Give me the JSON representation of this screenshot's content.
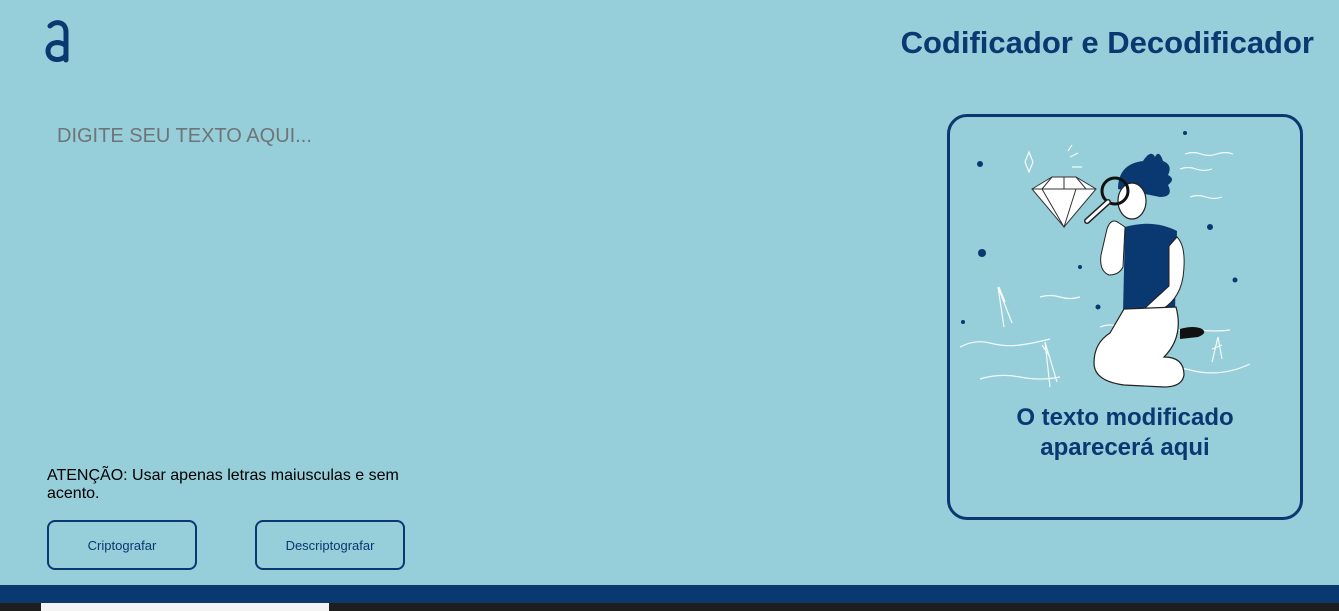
{
  "header": {
    "logo_icon": "alura-logo-icon",
    "title": "Codificador e Decodificador"
  },
  "editor": {
    "placeholder": "DIGITE SEU TEXTO AQUI..."
  },
  "warning": {
    "text": "ATENÇÃO: Usar apenas letras maiusculas e sem acento."
  },
  "buttons": {
    "encrypt_label": "Criptografar",
    "decrypt_label": "Descriptografar"
  },
  "output": {
    "illustration_icon": "person-with-magnifying-glass-and-diamond-illustration",
    "message": "O texto modificado aparecerá aqui"
  },
  "colors": {
    "background": "#96ced9",
    "accent": "#0a3871"
  }
}
